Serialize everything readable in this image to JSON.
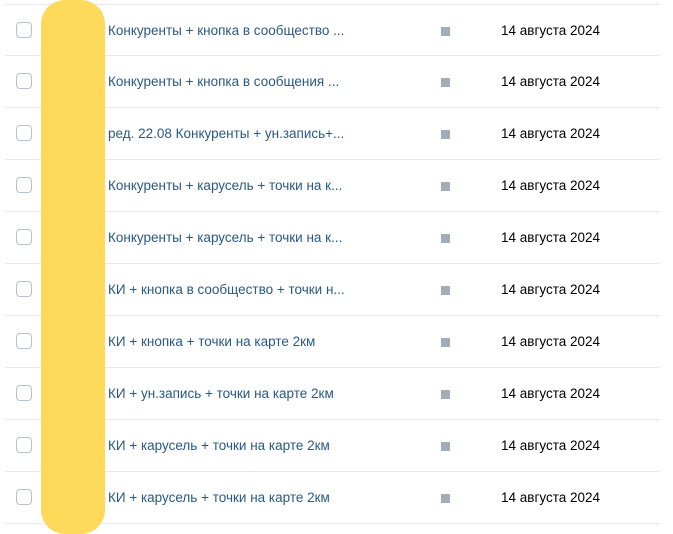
{
  "colors": {
    "link": "#2a5885",
    "status_square": "#a3adb8",
    "redaction": "#ffd95a",
    "divider": "#e7e8ec"
  },
  "icons": {
    "checkbox": "checkbox-icon",
    "status": "status-square-icon"
  },
  "rows": [
    {
      "name": "Конкуренты + кнопка в сообщество ...",
      "date": "14 августа 2024"
    },
    {
      "name": "Конкуренты + кнопка в сообщения ...",
      "date": "14 августа 2024"
    },
    {
      "name": "ред. 22.08 Конкуренты + ун.запись+...",
      "date": "14 августа 2024"
    },
    {
      "name": "Конкуренты + карусель + точки на к...",
      "date": "14 августа 2024"
    },
    {
      "name": "Конкуренты + карусель + точки на к...",
      "date": "14 августа 2024"
    },
    {
      "name": "КИ + кнопка в сообщество + точки н...",
      "date": "14 августа 2024"
    },
    {
      "name": "КИ + кнопка + точки на карте 2км",
      "date": "14 августа 2024"
    },
    {
      "name": "КИ + ун.запись + точки на карте 2км",
      "date": "14 августа 2024"
    },
    {
      "name": "КИ + карусель + точки на карте 2км",
      "date": "14 августа 2024"
    },
    {
      "name": "КИ + карусель + точки на карте 2км",
      "date": "14 августа 2024"
    }
  ]
}
